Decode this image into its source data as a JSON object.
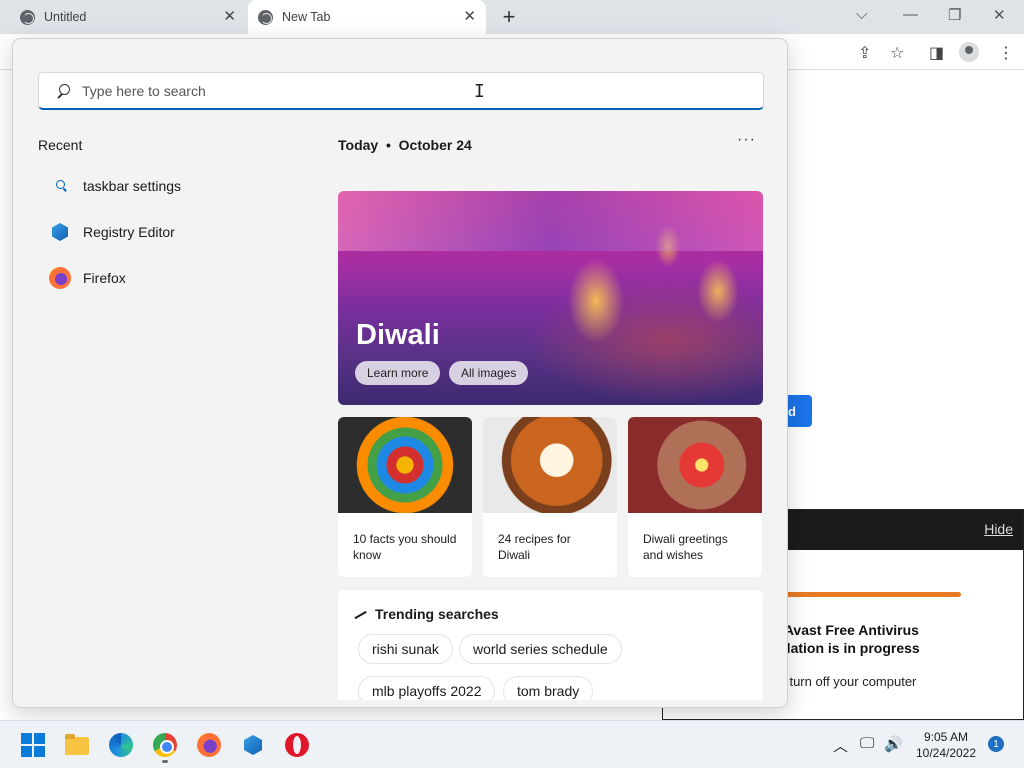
{
  "browser": {
    "tabs": [
      {
        "title": "Untitled"
      },
      {
        "title": "New Tab"
      }
    ],
    "page_button_label": "d"
  },
  "start_panel": {
    "search": {
      "placeholder": "Type here to search",
      "value": ""
    },
    "recent": {
      "title": "Recent",
      "items": [
        {
          "label": "taskbar settings",
          "icon": "search-icon"
        },
        {
          "label": "Registry Editor",
          "icon": "registry-editor-icon"
        },
        {
          "label": "Firefox",
          "icon": "firefox-icon"
        }
      ]
    },
    "today": {
      "label": "Today",
      "date": "October 24"
    },
    "hero": {
      "title": "Diwali",
      "buttons": [
        "Learn more",
        "All images"
      ]
    },
    "cards": [
      {
        "caption": "10 facts you should know"
      },
      {
        "caption": "24 recipes for Diwali"
      },
      {
        "caption": "Diwali greetings and wishes"
      }
    ],
    "trending": {
      "title": "Trending searches",
      "chips": [
        "rishi sunak",
        "world series schedule",
        "mlb playoffs 2022",
        "tom brady"
      ]
    }
  },
  "avast_dialog": {
    "hide_label": "Hide",
    "progress": 0.6,
    "title_line1": "r Avast Free Antivirus",
    "title_line2": "allation is in progress",
    "subtitle": "ot turn off your computer"
  },
  "taskbar": {
    "apps": [
      "windows-start",
      "file-explorer",
      "edge",
      "chrome",
      "firefox",
      "registry-editor",
      "opera"
    ],
    "time": "9:05 AM",
    "date": "10/24/2022",
    "notification_count": "1"
  },
  "colors": {
    "accent": "#005fb8",
    "avast_progress": "#e87a24",
    "page_button": "#1a73e8"
  }
}
